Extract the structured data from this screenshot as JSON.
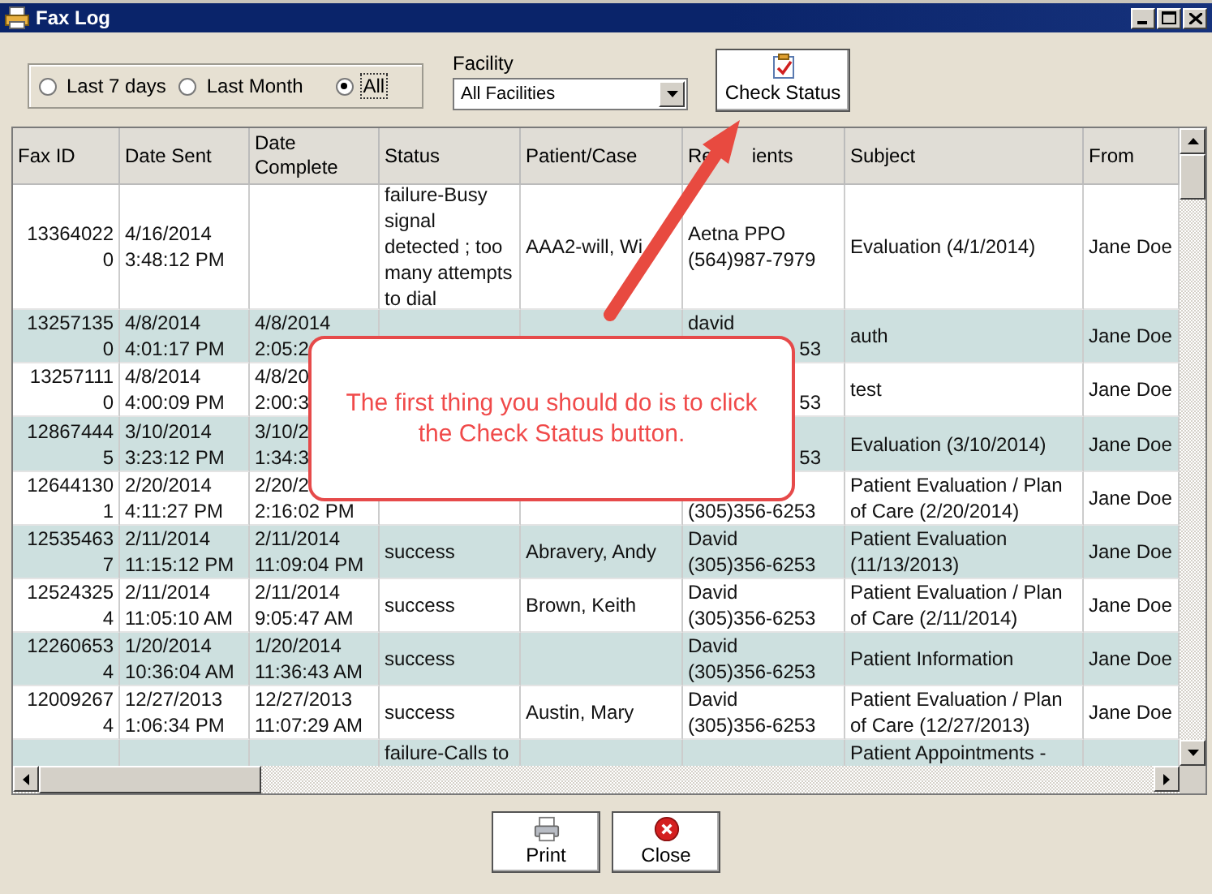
{
  "window": {
    "title": "Fax Log"
  },
  "date_filter": [
    {
      "label": "Last 7 days",
      "selected": false
    },
    {
      "label": "Last Month",
      "selected": false
    },
    {
      "label": "All",
      "selected": true
    }
  ],
  "facility": {
    "label": "Facility",
    "value": "All Facilities"
  },
  "check_status_button": {
    "label": "Check Status"
  },
  "table": {
    "columns": [
      {
        "label": [
          "Fax ID"
        ]
      },
      {
        "label": [
          "Date Sent"
        ]
      },
      {
        "label": [
          "Date",
          "Complete"
        ]
      },
      {
        "label": [
          "Status"
        ]
      },
      {
        "label": [
          "Patient/Case"
        ]
      },
      {
        "label": [
          "Re",
          "ients"
        ]
      },
      {
        "label": [
          "Subject"
        ]
      },
      {
        "label": [
          "From"
        ]
      }
    ],
    "rows": [
      [
        [
          "13364022",
          "0"
        ],
        [
          "4/16/2014",
          "3:48:12 PM"
        ],
        null,
        [
          "failure-Busy",
          "signal",
          "detected ; too",
          "many attempts",
          "to dial"
        ],
        [
          "AAA2-will, Wi"
        ],
        [
          "Aetna PPO",
          "(564)987-7979"
        ],
        [
          "Evaluation (4/1/2014)"
        ],
        [
          "Jane Doe"
        ]
      ],
      [
        [
          "13257135",
          "0"
        ],
        [
          "4/8/2014",
          "4:01:17 PM"
        ],
        [
          "4/8/2014",
          "2:05:2"
        ],
        null,
        null,
        {
          "lines": [
            "david",
            "53"
          ],
          "left_part_hidden": true
        },
        [
          "auth"
        ],
        [
          "Jane Doe"
        ]
      ],
      [
        [
          "13257111",
          "0"
        ],
        [
          "4/8/2014",
          "4:00:09 PM"
        ],
        [
          "4/8/20",
          "2:00:3"
        ],
        null,
        null,
        {
          "lines": [
            "53"
          ],
          "left_part_hidden": true,
          "top_part_hidden": true
        },
        [
          "test"
        ],
        [
          "Jane Doe"
        ]
      ],
      [
        [
          "12867444",
          "5"
        ],
        [
          "3/10/2014",
          "3:23:12 PM"
        ],
        [
          "3/10/2",
          "1:34:3"
        ],
        null,
        null,
        {
          "lines": [
            "53"
          ],
          "left_part_hidden": true,
          "top_part_hidden": true
        },
        [
          "Evaluation (3/10/2014)"
        ],
        [
          "Jane Doe"
        ]
      ],
      [
        [
          "12644130",
          "1"
        ],
        [
          "2/20/2014",
          "4:11:27 PM"
        ],
        [
          "2/20/2",
          "2:16:02 PM"
        ],
        null,
        null,
        {
          "lines": [
            "(305)356-6253"
          ],
          "left_part_hidden": false,
          "top_part_hidden": true
        },
        [
          "Patient Evaluation / Plan",
          "of Care (2/20/2014)"
        ],
        [
          "Jane Doe"
        ]
      ],
      [
        [
          "12535463",
          "7"
        ],
        [
          "2/11/2014",
          "11:15:12 PM"
        ],
        [
          "2/11/2014",
          "11:09:04 PM"
        ],
        [
          "success"
        ],
        [
          "Abravery, Andy"
        ],
        [
          "David",
          "(305)356-6253"
        ],
        [
          "Patient Evaluation",
          "(11/13/2013)"
        ],
        [
          "Jane Doe"
        ]
      ],
      [
        [
          "12524325",
          "4"
        ],
        [
          "2/11/2014",
          "11:05:10 AM"
        ],
        [
          "2/11/2014",
          "9:05:47 AM"
        ],
        [
          "success"
        ],
        [
          "Brown, Keith"
        ],
        [
          "David",
          "(305)356-6253"
        ],
        [
          "Patient Evaluation / Plan",
          "of Care (2/11/2014)"
        ],
        [
          "Jane Doe"
        ]
      ],
      [
        [
          "12260653",
          "4"
        ],
        [
          "1/20/2014",
          "10:36:04 AM"
        ],
        [
          "1/20/2014",
          "11:36:43 AM"
        ],
        [
          "success"
        ],
        null,
        [
          "David",
          "(305)356-6253"
        ],
        [
          "Patient Information"
        ],
        [
          "Jane Doe"
        ]
      ],
      [
        [
          "12009267",
          "4"
        ],
        [
          "12/27/2013",
          "1:06:34 PM"
        ],
        [
          "12/27/2013",
          "11:07:29 AM"
        ],
        [
          "success"
        ],
        [
          "Austin, Mary"
        ],
        [
          "David",
          "(305)356-6253"
        ],
        [
          "Patient Evaluation / Plan",
          "of Care (12/27/2013)"
        ],
        [
          "Jane Doe"
        ]
      ],
      [
        null,
        null,
        null,
        [
          "failure-Calls to"
        ],
        null,
        null,
        [
          "Patient Appointments -"
        ],
        null
      ]
    ]
  },
  "callout": {
    "text": "The first thing you should do is to click the Check Status button."
  },
  "buttons": [
    {
      "kind": "print",
      "label": "Print"
    },
    {
      "kind": "close",
      "label": "Close"
    }
  ]
}
